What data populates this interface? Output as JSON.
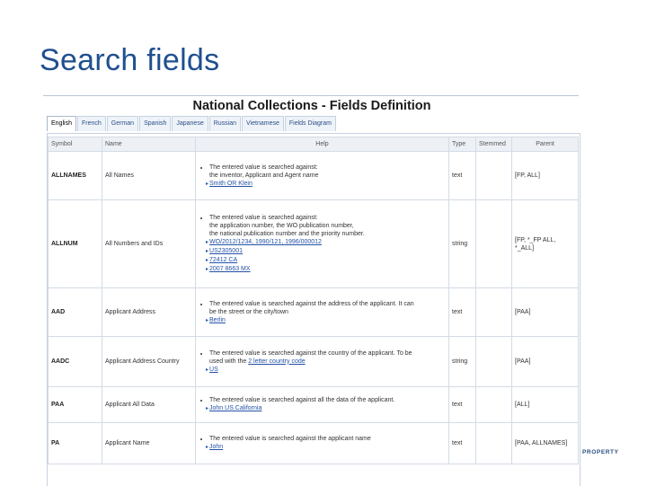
{
  "slide": {
    "title": "Search fields",
    "watermark": "PROPERTY"
  },
  "screenshot": {
    "title": "National Collections - Fields Definition",
    "tabs": [
      "English",
      "French",
      "German",
      "Spanish",
      "Japanese",
      "Russian",
      "Vietnamese",
      "Fields Diagram"
    ],
    "active_tab": "English",
    "columns": {
      "symbol": "Symbol",
      "name": "Name",
      "help": "Help",
      "type": "Type",
      "stemmed": "Stemmed",
      "parent": "Parent"
    },
    "rows": [
      {
        "symbol": "ALLNAMES",
        "name": "All Names",
        "help": [
          "The entered value is searched against:",
          "the inventor, Applicant and Agent name"
        ],
        "examples": [
          "Smith OR Klein"
        ],
        "type": "text",
        "parent": "[FP, ALL]"
      },
      {
        "symbol": "ALLNUM",
        "name": "All Numbers and IDs",
        "help": [
          "The entered value is searched against:",
          "the application number, the WO publication number,",
          "the national publication number and the priority number."
        ],
        "examples": [
          "WO/2012/1234, 1990/121, 1996/000012",
          "US2305001",
          "72412 CA",
          "2007 8663 MX"
        ],
        "type": "string",
        "parent": "[FP, *_FP ALL, *_ALL]"
      },
      {
        "symbol": "AAD",
        "name": "Applicant Address",
        "help": [
          "The entered value is searched against the address of the applicant. It can",
          "be the street or the city/town"
        ],
        "examples": [
          "Berlin"
        ],
        "type": "text",
        "parent": "[PAA]"
      },
      {
        "symbol": "AADC",
        "name": "Applicant Address Country",
        "help_parts": [
          "The entered value is searched against the country of the applicant. To be",
          "used with the ",
          "2 letter country code"
        ],
        "examples": [
          "US"
        ],
        "type": "string",
        "parent": "[PAA]"
      },
      {
        "symbol": "PAA",
        "name": "Applicant All Data",
        "help": [
          "The entered value is searched against all the data of the applicant."
        ],
        "examples": [
          "John US California"
        ],
        "type": "text",
        "parent": "[ALL]"
      },
      {
        "symbol": "PA",
        "name": "Applicant Name",
        "help": [
          "The entered value is searched against the applicant name"
        ],
        "examples": [
          "John"
        ],
        "type": "text",
        "parent": "[PAA, ALLNAMES]"
      }
    ]
  }
}
